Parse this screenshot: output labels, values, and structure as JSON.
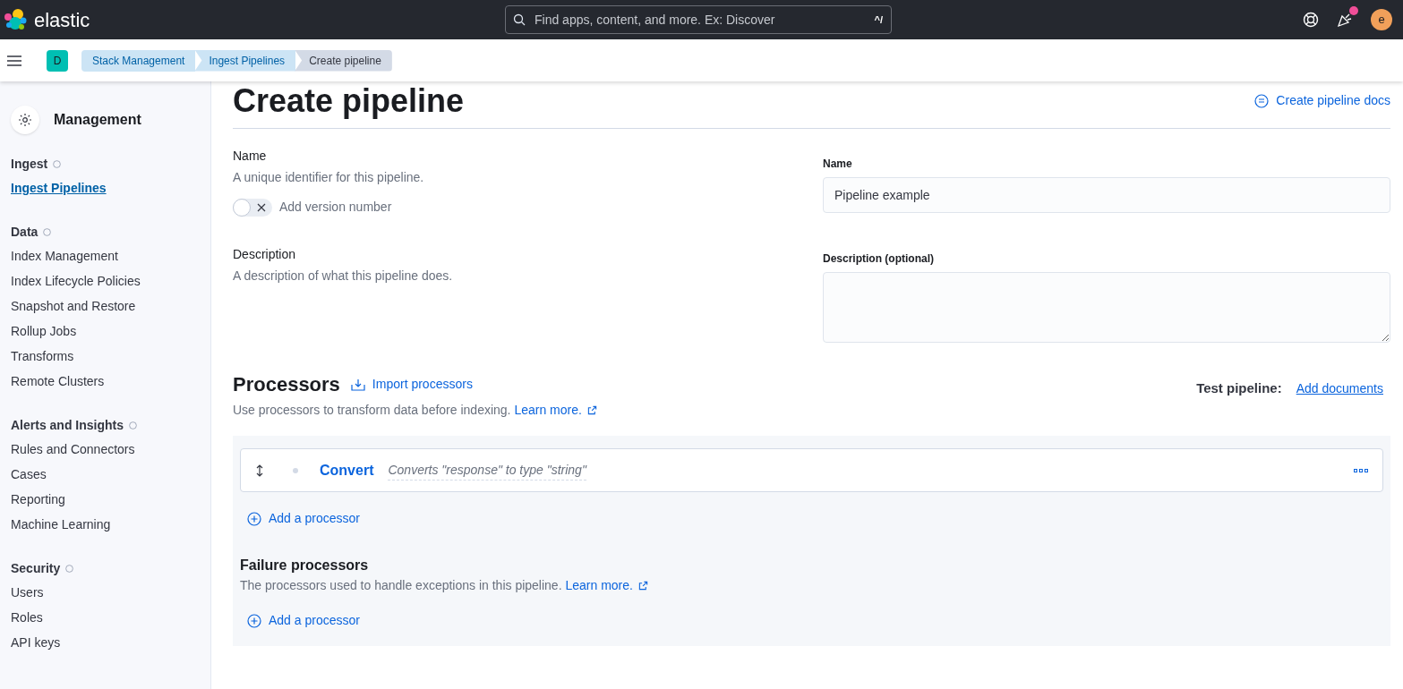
{
  "header": {
    "logo_text": "elastic",
    "search": {
      "placeholder": "Find apps, content, and more. Ex: Discover",
      "shortcut": "^/"
    },
    "news_unread": true,
    "avatar": "e"
  },
  "breadcrumbs": {
    "space": "D",
    "items": [
      {
        "label": "Stack Management",
        "selected": false
      },
      {
        "label": "Ingest Pipelines",
        "selected": false
      },
      {
        "label": "Create pipeline",
        "selected": true
      }
    ]
  },
  "sidebar": {
    "title": "Management",
    "groups": [
      {
        "label": "Ingest",
        "items": [
          {
            "label": "Ingest Pipelines",
            "selected": true
          }
        ]
      },
      {
        "label": "Data",
        "items": [
          {
            "label": "Index Management",
            "selected": false
          },
          {
            "label": "Index Lifecycle Policies",
            "selected": false
          },
          {
            "label": "Snapshot and Restore",
            "selected": false
          },
          {
            "label": "Rollup Jobs",
            "selected": false
          },
          {
            "label": "Transforms",
            "selected": false
          },
          {
            "label": "Remote Clusters",
            "selected": false
          }
        ]
      },
      {
        "label": "Alerts and Insights",
        "items": [
          {
            "label": "Rules and Connectors",
            "selected": false
          },
          {
            "label": "Cases",
            "selected": false
          },
          {
            "label": "Reporting",
            "selected": false
          },
          {
            "label": "Machine Learning",
            "selected": false
          }
        ]
      },
      {
        "label": "Security",
        "items": [
          {
            "label": "Users",
            "selected": false
          },
          {
            "label": "Roles",
            "selected": false
          },
          {
            "label": "API keys",
            "selected": false
          }
        ]
      }
    ]
  },
  "page": {
    "title": "Create pipeline",
    "docs_link": "Create pipeline docs",
    "name_section": {
      "title": "Name",
      "description": "A unique identifier for this pipeline.",
      "version_toggle": {
        "label": "Add version number",
        "on": false
      },
      "field_label": "Name",
      "value": "Pipeline example"
    },
    "description_section": {
      "title": "Description",
      "description": "A description of what this pipeline does.",
      "field_label": "Description (optional)"
    },
    "processors": {
      "title": "Processors",
      "import_link": "Import processors",
      "description": "Use processors to transform data before indexing.",
      "learn_more": "Learn more.",
      "test_label": "Test pipeline:",
      "test_link": "Add documents",
      "items": [
        {
          "name": "Convert",
          "summary": "Converts \"response\" to type \"string\""
        }
      ],
      "add_link": "Add a processor",
      "failure": {
        "title": "Failure processors",
        "description": "The processors used to handle exceptions in this pipeline.",
        "learn_more": "Learn more.",
        "add_link": "Add a processor"
      }
    }
  }
}
